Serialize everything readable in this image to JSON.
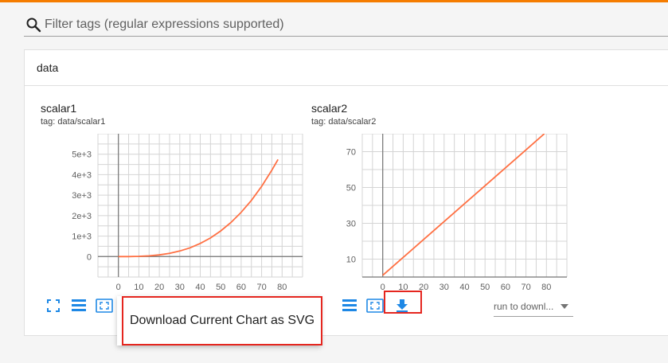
{
  "filter": {
    "placeholder": "Filter tags (regular expressions supported)",
    "value": ""
  },
  "category": {
    "title": "data"
  },
  "cards": [
    {
      "title": "scalar1",
      "tag": "tag: data/scalar1",
      "chart_data": {
        "type": "line",
        "x": [
          0,
          5,
          10,
          15,
          20,
          25,
          30,
          35,
          40,
          45,
          50,
          55,
          60,
          65,
          70,
          75,
          78
        ],
        "series": [
          {
            "values": [
              0,
              1.25,
              10,
              33.75,
              80,
              156,
              270,
              429,
              640,
              911,
              1250,
              1664,
              2160,
              2746,
              3430,
              4219,
              4745
            ]
          }
        ],
        "xticks": [
          "0",
          "10",
          "20",
          "30",
          "40",
          "50",
          "60",
          "70",
          "80"
        ],
        "yticks": [
          "0",
          "1e+3",
          "2e+3",
          "3e+3",
          "4e+3",
          "5e+3"
        ],
        "xlim": [
          -10,
          90
        ],
        "ylim": [
          -1000,
          6000
        ],
        "color": "#ff7043",
        "grid": true
      }
    },
    {
      "title": "scalar2",
      "tag": "tag: data/scalar2",
      "chart_data": {
        "type": "line",
        "x": [
          0,
          10,
          20,
          30,
          40,
          50,
          60,
          70,
          79
        ],
        "series": [
          {
            "values": [
              1,
              11,
              21,
              31,
              41,
              51,
              61,
              71,
              80
            ]
          }
        ],
        "xticks": [
          "0",
          "10",
          "20",
          "30",
          "40",
          "50",
          "60",
          "70",
          "80"
        ],
        "yticks": [
          "10",
          "30",
          "50",
          "70"
        ],
        "xlim": [
          -10,
          90
        ],
        "ylim": [
          0,
          80
        ],
        "color": "#ff7043",
        "grid": true
      }
    }
  ],
  "toolbar": {
    "expand_icon": "fullscreen-icon",
    "data_icon": "list-icon",
    "fit_icon": "fit-domain-icon",
    "download_icon": "download-icon"
  },
  "tooltip": {
    "text": "Download Current Chart as SVG"
  },
  "run_select": {
    "value": "run to downl..."
  },
  "colors": {
    "accent": "#f57c00",
    "line": "#ff7043",
    "icon": "#1e88e5",
    "highlight": "#e5261f"
  }
}
